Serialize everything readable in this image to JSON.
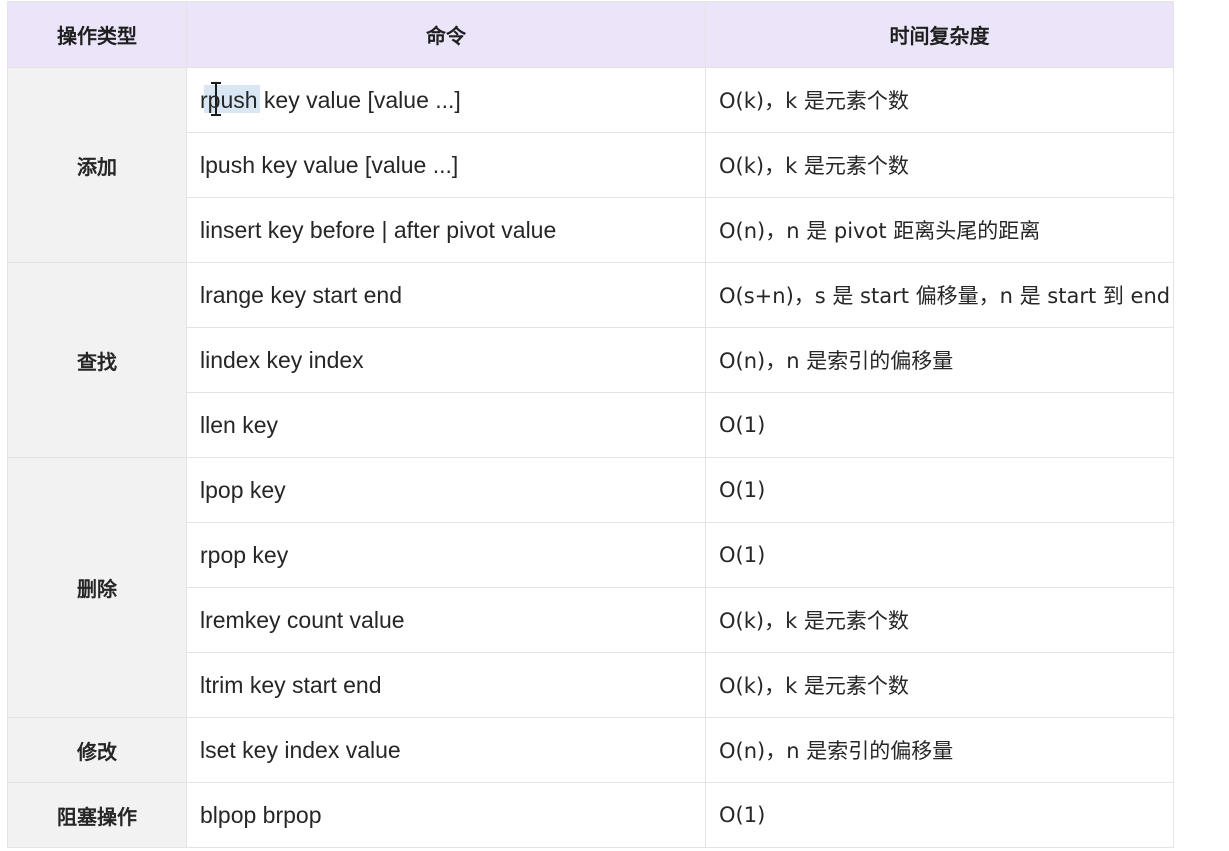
{
  "table": {
    "headers": [
      "操作类型",
      "命令",
      "时间复杂度"
    ],
    "groups": [
      {
        "type": "添加",
        "rows": [
          {
            "command": "rpush key value [value ...]",
            "complexity": "O(k)，k 是元素个数"
          },
          {
            "command": "lpush key value [value ...]",
            "complexity": "O(k)，k 是元素个数"
          },
          {
            "command": "linsert key before | after pivot value",
            "complexity": "O(n)，n 是 pivot 距离头尾的距离"
          }
        ]
      },
      {
        "type": "查找",
        "rows": [
          {
            "command": "lrange key start end",
            "complexity": "O(s+n)，s 是 start 偏移量，n 是 start 到 end"
          },
          {
            "command": "lindex key index",
            "complexity": "O(n)，n 是索引的偏移量"
          },
          {
            "command": "llen key",
            "complexity": "O(1)"
          }
        ]
      },
      {
        "type": "删除",
        "rows": [
          {
            "command": "lpop key",
            "complexity": "O(1)"
          },
          {
            "command": "rpop key",
            "complexity": "O(1)"
          },
          {
            "command": "lremkey count value",
            "complexity": "O(k)，k 是元素个数"
          },
          {
            "command": "ltrim key start end",
            "complexity": "O(k)，k 是元素个数"
          }
        ]
      },
      {
        "type": "修改",
        "rows": [
          {
            "command": "lset key index value",
            "complexity": "O(n)，n 是索引的偏移量"
          }
        ]
      },
      {
        "type": "阻塞操作",
        "rows": [
          {
            "command": "blpop brpop",
            "complexity": "O(1)"
          }
        ]
      }
    ]
  },
  "colors": {
    "header_bg": "#ece4f8",
    "type_cell_bg": "#f2f2f3",
    "border": "#e4e4e6",
    "selection_highlight": "#508cc8"
  },
  "cursor": {
    "icon": "text-ibeam-cursor-icon"
  }
}
